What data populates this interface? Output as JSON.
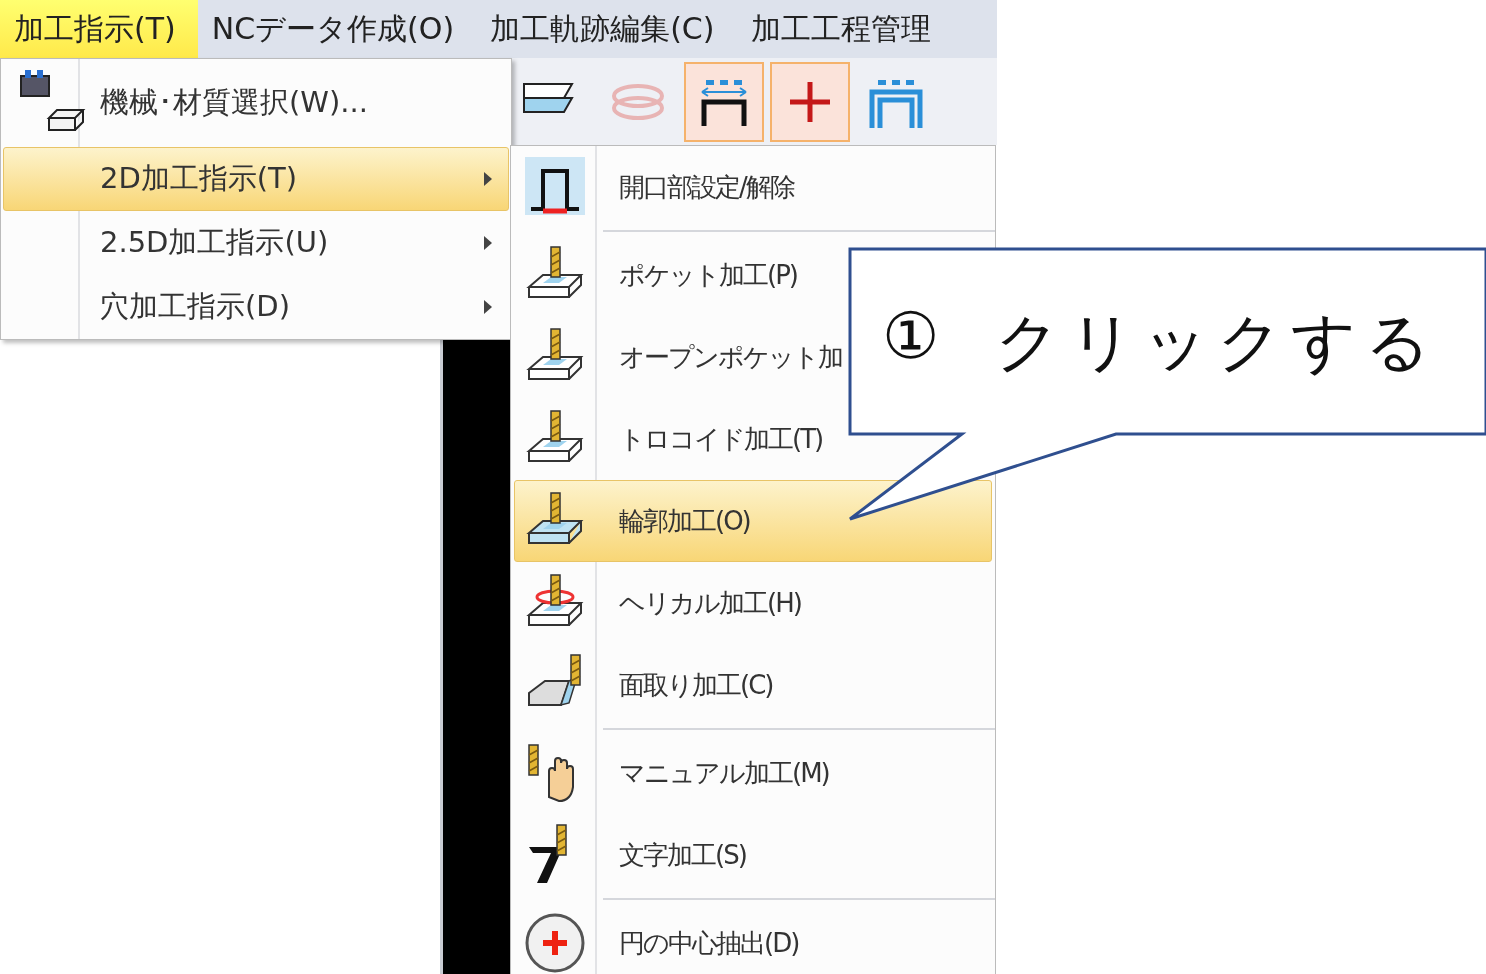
{
  "menubar": [
    {
      "label": "加工指示(T)",
      "selected": true
    },
    {
      "label": "NCデータ作成(O)",
      "selected": false
    },
    {
      "label": "加工軌跡編集(C)",
      "selected": false
    },
    {
      "label": "加工工程管理",
      "selected": false
    }
  ],
  "toolbar": {
    "buttons": [
      {
        "kind": "layers",
        "checked": false
      },
      {
        "kind": "rings",
        "checked": false
      },
      {
        "kind": "dimension",
        "checked": true
      },
      {
        "kind": "plus",
        "checked": true
      },
      {
        "kind": "frame",
        "checked": false
      }
    ]
  },
  "dropdown": {
    "items": [
      {
        "label": "機械･材質選択(W)...",
        "kind": "machine",
        "selected": false,
        "submenu": false
      },
      {
        "label": "2D加工指示(T)",
        "kind": "plain",
        "selected": true,
        "submenu": true
      },
      {
        "label": "2.5D加工指示(U)",
        "kind": "plain",
        "selected": false,
        "submenu": true
      },
      {
        "label": "穴加工指示(D)",
        "kind": "plain",
        "selected": false,
        "submenu": true
      }
    ]
  },
  "submenu": {
    "groups": [
      [
        {
          "label": "開口部設定/解除",
          "kind": "opening",
          "selected": false
        }
      ],
      [
        {
          "label": "ポケット加工(P)",
          "kind": "pocket",
          "selected": false
        },
        {
          "label": "オープンポケット加",
          "kind": "open-pocket",
          "selected": false
        },
        {
          "label": "トロコイド加工(T)",
          "kind": "trochoid",
          "selected": false
        },
        {
          "label": "輪郭加工(O)",
          "kind": "contour",
          "selected": true
        },
        {
          "label": "ヘリカル加工(H)",
          "kind": "helical",
          "selected": false
        },
        {
          "label": "面取り加工(C)",
          "kind": "chamfer",
          "selected": false
        }
      ],
      [
        {
          "label": "マニュアル加工(M)",
          "kind": "manual",
          "selected": false
        },
        {
          "label": "文字加工(S)",
          "kind": "text",
          "selected": false
        }
      ],
      [
        {
          "label": "円の中心抽出(D)",
          "kind": "circle",
          "selected": false
        }
      ]
    ]
  },
  "callout": {
    "number": "①",
    "text": "クリックする"
  }
}
